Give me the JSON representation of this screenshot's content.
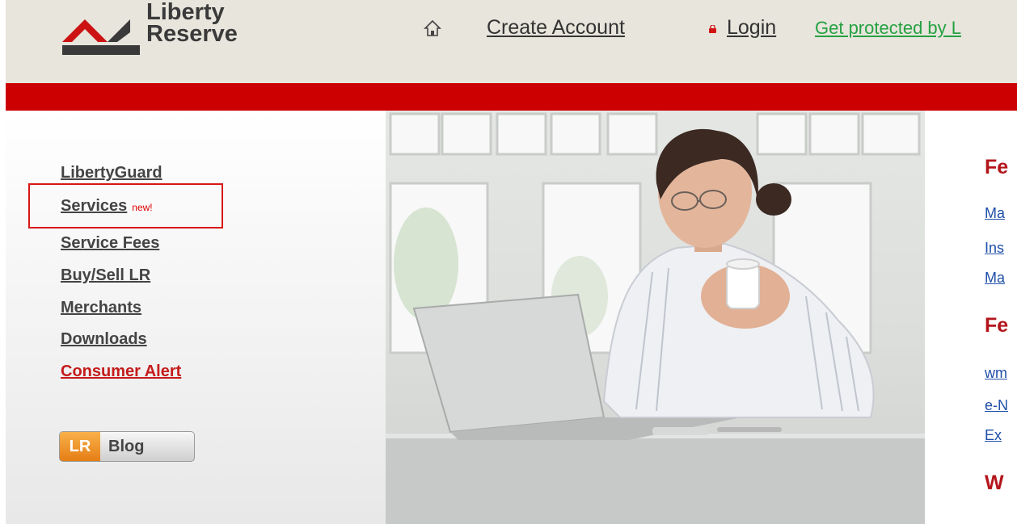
{
  "header": {
    "logo": {
      "line1": "Liberty",
      "line2": "Reserve"
    },
    "nav": {
      "home_icon": "home-icon",
      "create_account": "Create Account",
      "login_icon": "lock-icon",
      "login": "Login",
      "protect": "Get protected by L"
    },
    "colors": {
      "header_bg": "#e7e5dc",
      "red_bar": "#cc0000",
      "protect_link": "#26a142"
    }
  },
  "sidebar": {
    "items": [
      {
        "label": "LibertyGuard"
      },
      {
        "label": "Services",
        "badge": "new!"
      },
      {
        "label": "Service Fees"
      },
      {
        "label": "Buy/Sell LR"
      },
      {
        "label": "Merchants"
      },
      {
        "label": "Downloads"
      },
      {
        "label": "Consumer Alert"
      }
    ],
    "blog_button": {
      "prefix": "LR",
      "label": "Blog"
    }
  },
  "right_column": {
    "headings": [
      "Fe",
      "Fe",
      "W"
    ],
    "links_group1": [
      "Ma",
      "Ins",
      "Ma"
    ],
    "links_group2": [
      "wm",
      "e-N",
      "Ex"
    ]
  }
}
